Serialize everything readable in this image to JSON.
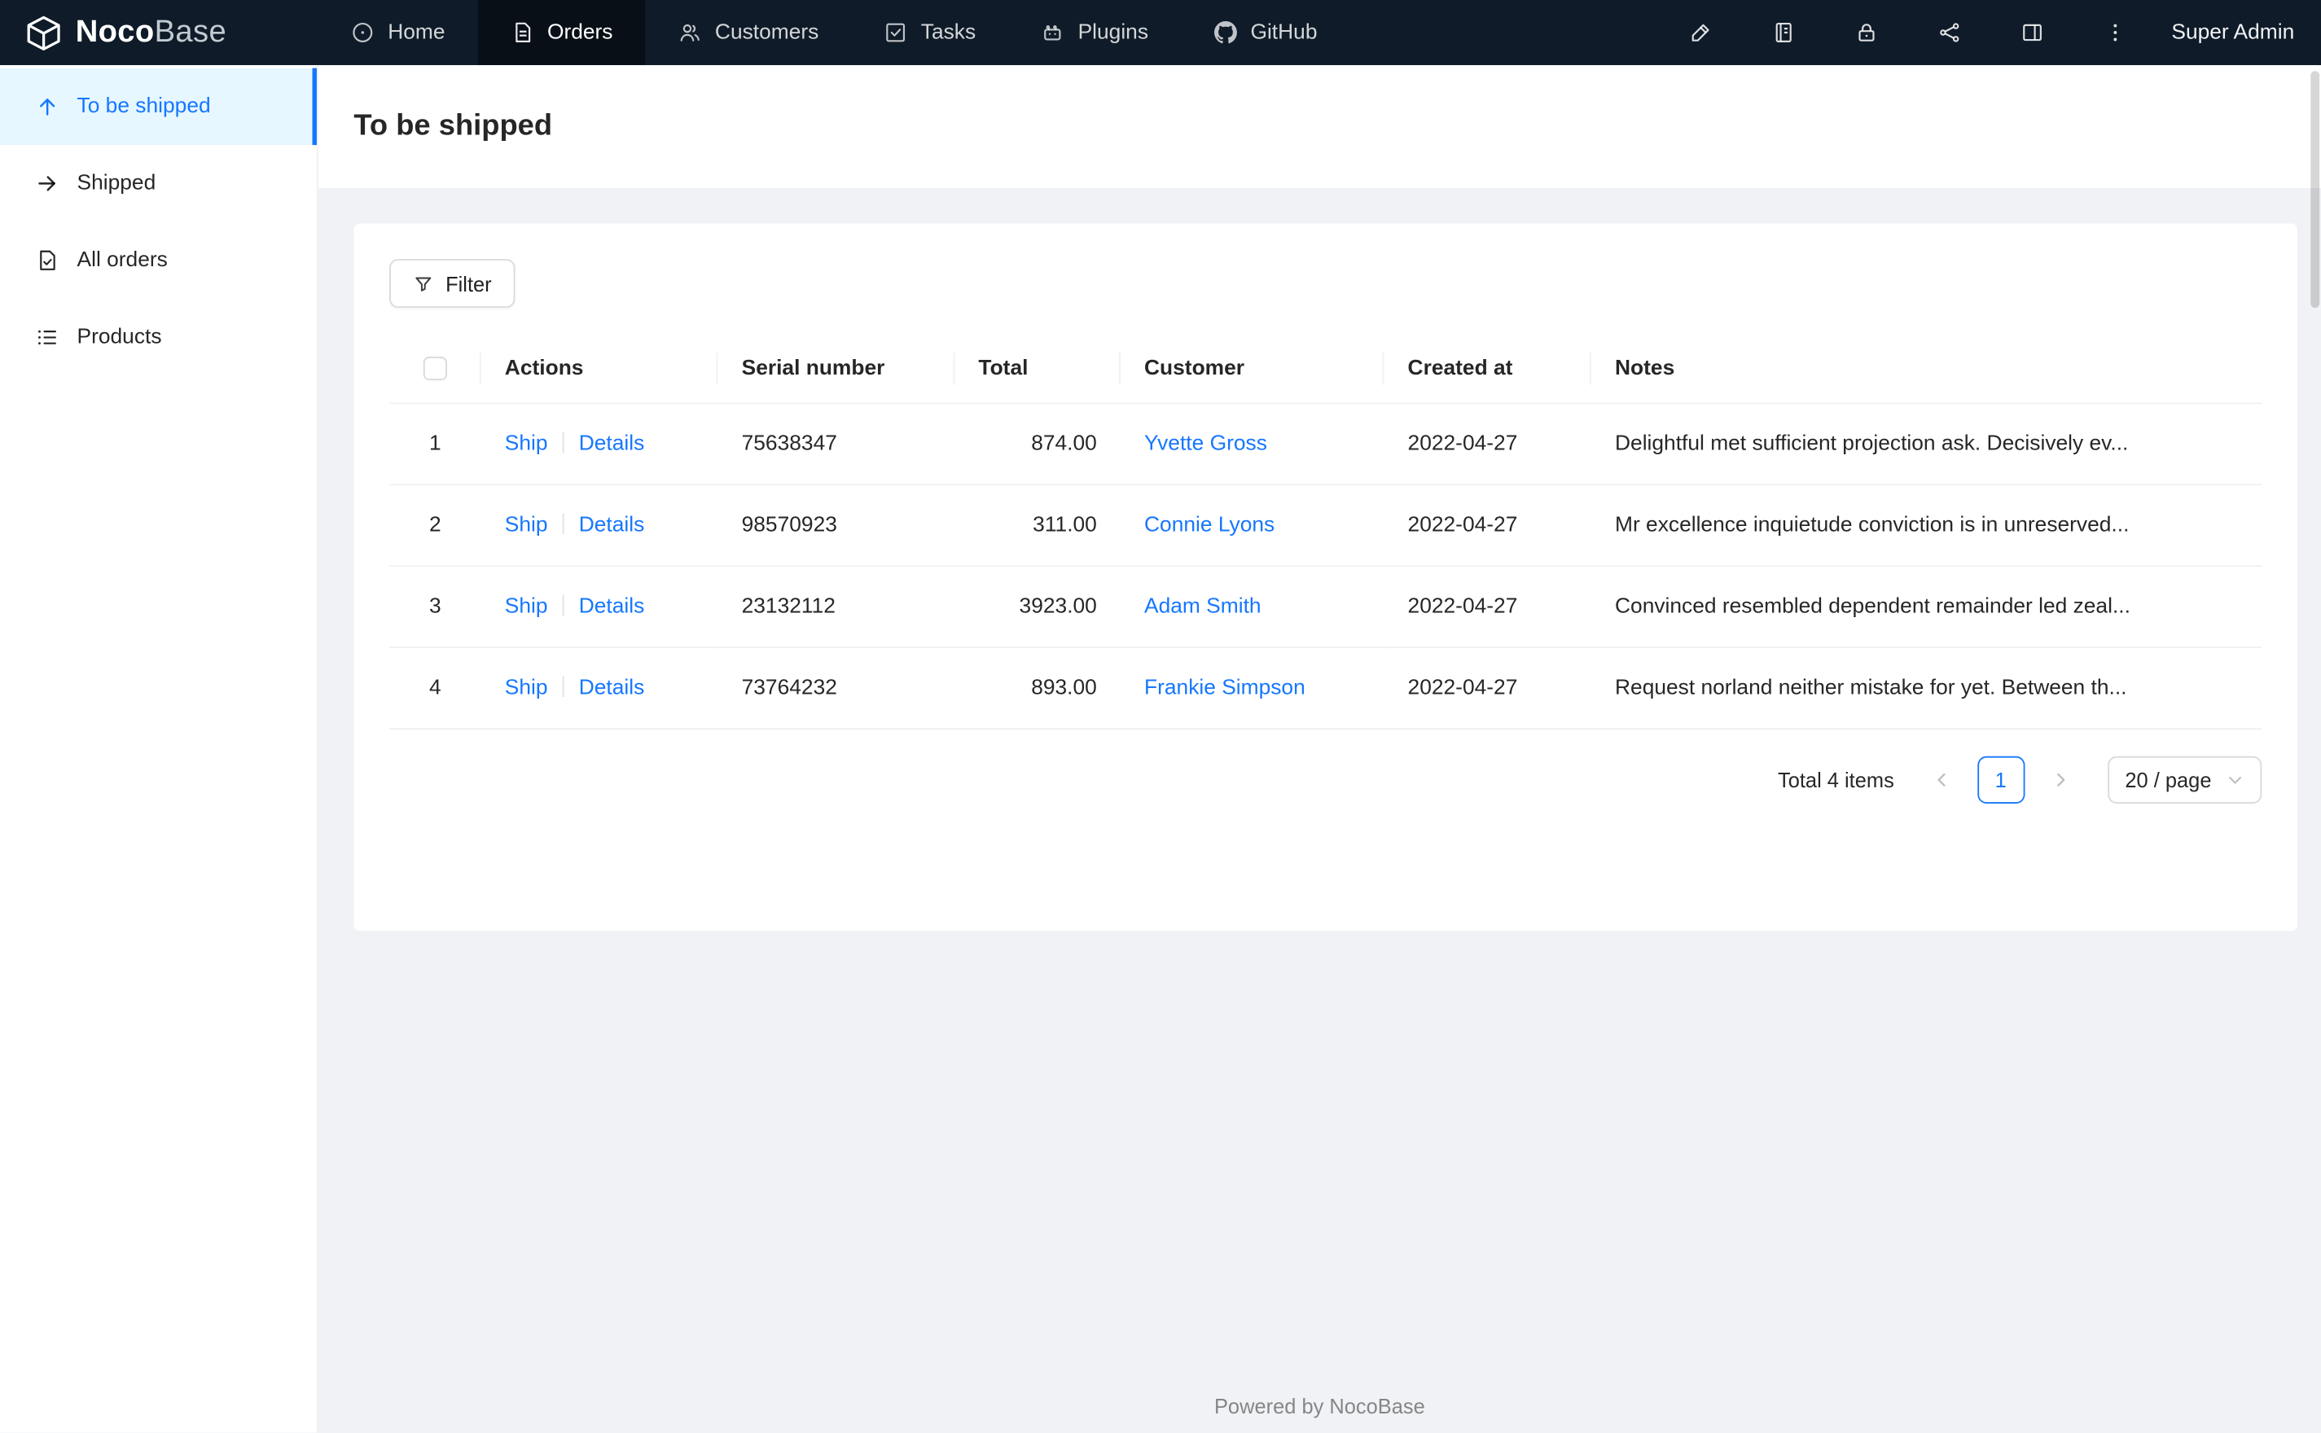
{
  "navbar": {
    "logo_primary": "Noco",
    "logo_secondary": "Base",
    "items": [
      {
        "label": "Home",
        "icon": "home-icon",
        "active": false
      },
      {
        "label": "Orders",
        "icon": "orders-icon",
        "active": true
      },
      {
        "label": "Customers",
        "icon": "customers-icon",
        "active": false
      },
      {
        "label": "Tasks",
        "icon": "tasks-icon",
        "active": false
      },
      {
        "label": "Plugins",
        "icon": "plugins-icon",
        "active": false
      },
      {
        "label": "GitHub",
        "icon": "github-icon",
        "active": false
      }
    ],
    "right_icons": [
      "highlighter-icon",
      "notebook-icon",
      "lock-icon",
      "api-icon",
      "layout-icon",
      "more-icon"
    ],
    "user_label": "Super Admin"
  },
  "sidebar": {
    "items": [
      {
        "label": "To be shipped",
        "icon": "arrow-up-icon",
        "active": true
      },
      {
        "label": "Shipped",
        "icon": "arrow-right-icon",
        "active": false
      },
      {
        "label": "All orders",
        "icon": "file-done-icon",
        "active": false
      },
      {
        "label": "Products",
        "icon": "list-icon",
        "active": false
      }
    ]
  },
  "page": {
    "title": "To be shipped"
  },
  "toolbar": {
    "filter_label": "Filter"
  },
  "table": {
    "action_labels": [
      "Ship",
      "Details"
    ],
    "columns": [
      "Actions",
      "Serial number",
      "Total",
      "Customer",
      "Created at",
      "Notes"
    ],
    "rows": [
      {
        "index": "1",
        "serial": "75638347",
        "total": "874.00",
        "customer": "Yvette Gross",
        "created_at": "2022-04-27",
        "notes": "Delightful met sufficient projection ask. Decisively ev..."
      },
      {
        "index": "2",
        "serial": "98570923",
        "total": "311.00",
        "customer": "Connie Lyons",
        "created_at": "2022-04-27",
        "notes": "Mr excellence inquietude conviction is in unreserved..."
      },
      {
        "index": "3",
        "serial": "23132112",
        "total": "3923.00",
        "customer": "Adam Smith",
        "created_at": "2022-04-27",
        "notes": "Convinced resembled dependent remainder led zeal..."
      },
      {
        "index": "4",
        "serial": "73764232",
        "total": "893.00",
        "customer": "Frankie Simpson",
        "created_at": "2022-04-27",
        "notes": "Request norland neither mistake for yet. Between th..."
      }
    ]
  },
  "pagination": {
    "total_label": "Total 4 items",
    "current_page": "1",
    "page_size_label": "20 / page"
  },
  "footer": {
    "text": "Powered by NocoBase"
  },
  "colors": {
    "accent": "#1677ff",
    "navbar_bg": "#0f1b28",
    "active_item_bg": "#e6f7ff",
    "link": "#1677ff"
  }
}
